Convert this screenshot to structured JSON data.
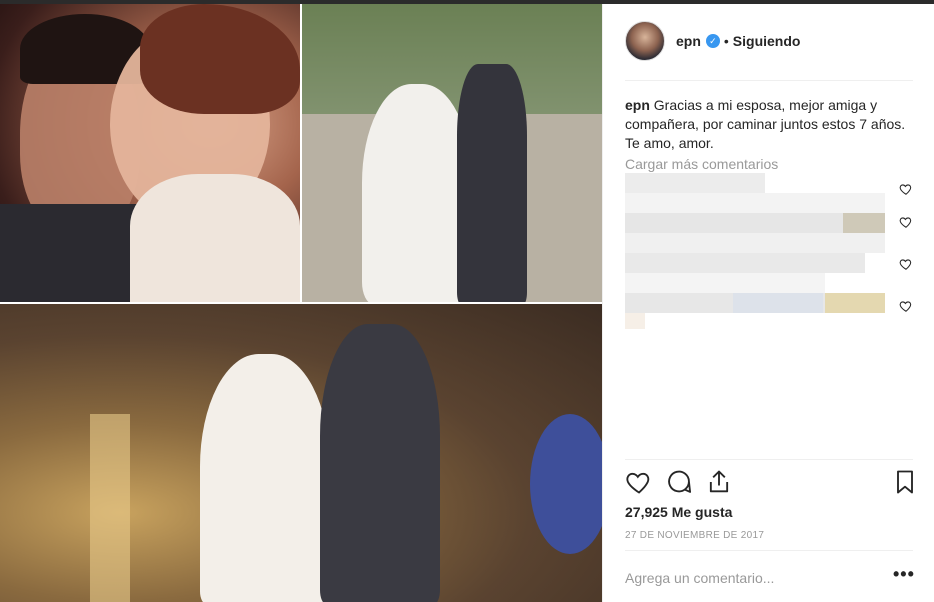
{
  "post": {
    "username": "epn",
    "verified_icon": "verified-badge-icon",
    "separator": "•",
    "follow_status": "Siguiendo",
    "caption_user": "epn",
    "caption_text": "Gracias a mi esposa, mejor amiga y compañera, por caminar juntos estos 7 años. Te amo, amor.",
    "load_more": "Cargar más comentarios",
    "likes": "27,925 Me gusta",
    "date": "27 DE NOVIEMBRE DE 2017",
    "comment_placeholder": "Agrega un comentario...",
    "more_options": "•••"
  },
  "colors": {
    "accent_blue": "#3897f0",
    "muted_text": "#999999",
    "divider": "#efefef"
  },
  "icons": [
    "heart-icon",
    "comment-icon",
    "share-icon",
    "bookmark-icon",
    "small-heart-icon"
  ]
}
